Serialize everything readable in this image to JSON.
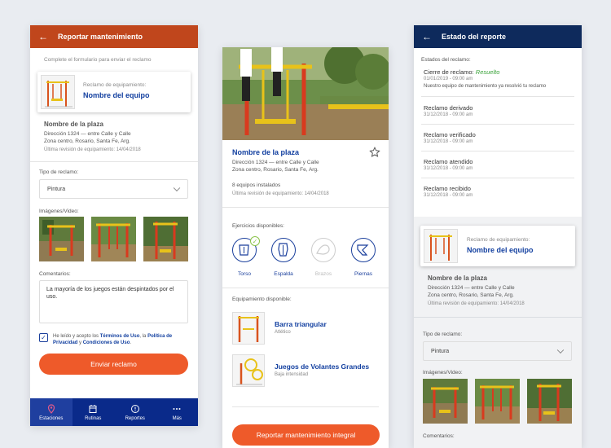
{
  "screen1": {
    "header_title": "Reportar mantenimiento",
    "intro": "Complete el formulario para enviar el reclamo",
    "equip_label": "Reclamo de equipamiento:",
    "equip_name": "Nombre del equipo",
    "plaza_name": "Nombre de la plaza",
    "address1": "Dirección 1324 — entre Calle y Calle",
    "address2": "Zona centro, Rosario, Santa Fe, Arg.",
    "revision": "Última revisión de equipamiento: 14/04/2018",
    "type_label": "Tipo de reclamo:",
    "type_value": "Pintura",
    "images_label": "Imágenes/Video:",
    "comments_label": "Comentarios:",
    "comment_text": "La mayoría de los juegos están despintados por el uso.",
    "terms_pre": "He leído y acepto los ",
    "terms_link1": "Términos de Uso",
    "terms_mid": ", la ",
    "terms_link2": "Política de Privacidad",
    "terms_and": " y ",
    "terms_link3": "Condiciones de Uso",
    "terms_end": ".",
    "submit": "Enviar reclamo",
    "nav": [
      {
        "label": "Estaciones",
        "icon": "location-pin-icon"
      },
      {
        "label": "Rutinas",
        "icon": "calendar-icon"
      },
      {
        "label": "Reportes",
        "icon": "alert-icon"
      },
      {
        "label": "Más",
        "icon": "more-icon"
      }
    ]
  },
  "screen2": {
    "plaza_name": "Nombre de la plaza",
    "address1": "Dirección 1324 — entre Calle y Calle",
    "address2": "Zona centro, Rosario, Santa Fe, Arg.",
    "installed": "8 equipos instalados",
    "revision": "Última revisión de equipamiento: 14/04/2018",
    "exercises_label": "Ejercicios disponibles:",
    "exercises": [
      {
        "label": "Torso",
        "state": "done"
      },
      {
        "label": "Espalda",
        "state": "active"
      },
      {
        "label": "Brazos",
        "state": "disabled"
      },
      {
        "label": "Piernas",
        "state": "active"
      }
    ],
    "equipment_label": "Equipamiento disponible:",
    "equipment": [
      {
        "name": "Barra triangular",
        "type": "Atlético"
      },
      {
        "name": "Juegos de Volantes Grandes",
        "type": "Baja intensidad"
      }
    ],
    "report_button": "Reportar mantenimiento integral"
  },
  "screen3": {
    "header_title": "Estado del reporte",
    "states_label": "Estados del reclamo:",
    "statuses": [
      {
        "title": "Cierre de reclamo:",
        "highlight": "Resuelto",
        "date": "01/01/2019 - 09:00 am",
        "note": "Nuestro equipo de mantenimiento ya resolvió tu reclamo"
      },
      {
        "title": "Reclamo derivado",
        "date": "31/12/2018 - 09:00 am"
      },
      {
        "title": "Reclamo verificado",
        "date": "31/12/2018 - 09:00 am"
      },
      {
        "title": "Reclamo atendido",
        "date": "31/12/2018 - 09:00 am"
      },
      {
        "title": "Reclamo recibido",
        "date": "31/12/2018 - 09:00 am"
      }
    ],
    "equip_label": "Reclamo de equipamiento:",
    "equip_name": "Nombre del equipo",
    "plaza_name": "Nombre de la plaza",
    "address1": "Dirección 1324 — entre Calle y Calle",
    "address2": "Zona centro, Rosario, Santa Fe, Arg.",
    "revision": "Última revisión de equipamiento: 14/04/2018",
    "type_label": "Tipo de reclamo:",
    "type_value": "Pintura",
    "images_label": "Imágenes/Video:",
    "comments_label": "Comentarios:"
  },
  "colors": {
    "header_red": "#c0461c",
    "header_navy": "#0e2a5c",
    "nav_blue": "#0a2a8a",
    "accent_orange": "#ee5a2a",
    "link_blue": "#1340a0",
    "success_green": "#3aa33a"
  }
}
